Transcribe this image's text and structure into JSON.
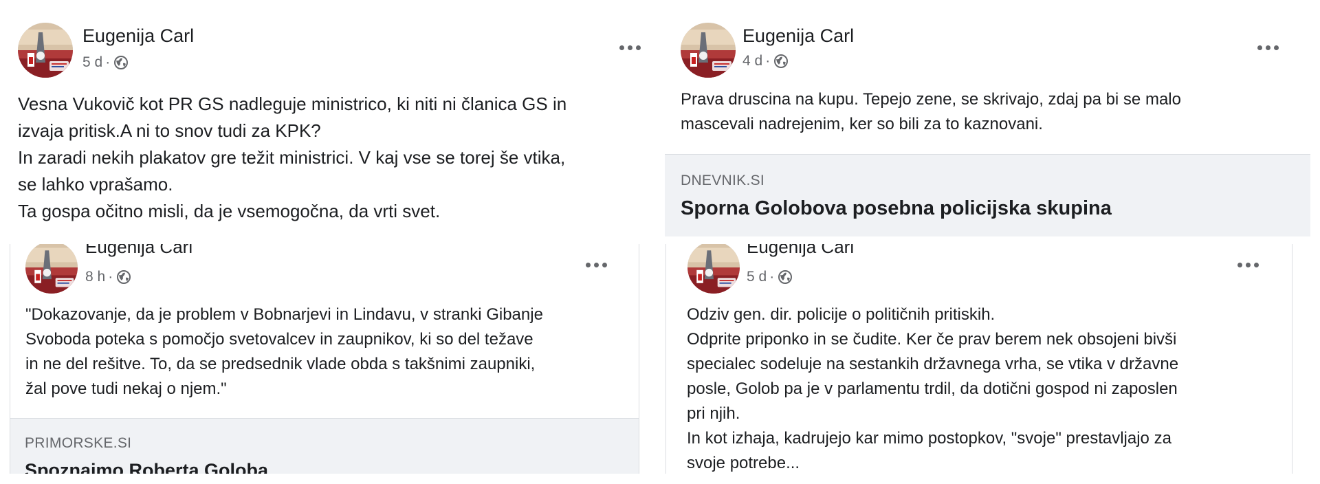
{
  "posts": [
    {
      "author": "Eugenija Carl",
      "time": "5 d",
      "separator": "·",
      "privacy_icon": "globe-icon",
      "lines": [
        "Vesna Vukovič kot PR GS  nadleguje ministrico, ki niti ni članica GS in",
        "izvaja pritisk.A ni to snov tudi za KPK?",
        "In zaradi nekih plakatov gre težit ministrici. V kaj vse se torej še vtika,",
        "se lahko vprašamo.",
        "Ta gospa očitno misli, da je vsemogočna, da vrti svet."
      ]
    },
    {
      "author": "Eugenija Carl",
      "time": "4 d",
      "separator": "·",
      "privacy_icon": "globe-icon",
      "lines": [
        "Prava druscina na kupu. Tepejo zene, se skrivajo, zdaj pa bi se malo",
        "mascevali nadrejenim, ker so bili za to kaznovani."
      ],
      "link": {
        "domain": "DNEVNIK.SI",
        "title": "Sporna Golobova posebna policijska skupina"
      }
    },
    {
      "author": "Eugenija Carl",
      "time": "8 h",
      "separator": "·",
      "privacy_icon": "globe-icon",
      "lines": [
        "\"Dokazovanje, da je problem v Bobnarjevi in Lindavu, v stranki Gibanje",
        "Svoboda poteka s pomočjo svetovalcev in zaupnikov, ki so del težave",
        "in ne del rešitve. To, da se predsednik vlade obda s takšnimi zaupniki,",
        "žal pove tudi nekaj o njem.\""
      ],
      "link": {
        "domain": "PRIMORSKE.SI",
        "title": "Spoznajmo Roberta Goloba"
      }
    },
    {
      "author": "Eugenija Carl",
      "time": "5 d",
      "separator": "·",
      "privacy_icon": "globe-icon",
      "lines": [
        "Odziv gen. dir. policije o političnih pritiskih.",
        "Odprite priponko in se čudite. Ker če prav berem nek obsojeni bivši",
        "specialec sodeluje na sestankih državnega vrha, se vtika v državne",
        "posle, Golob pa je v parlamentu trdil, da dotični gospod ni zaposlen",
        "pri njih.",
        "In kot izhaja, kadrujejo kar mimo postopkov, \"svoje\" prestavljajo za",
        "svoje potrebe..."
      ]
    }
  ],
  "colors": {
    "text": "#1c1e21",
    "secondary": "#65676b",
    "card_bg": "#f0f2f5",
    "divider": "#dadde1"
  }
}
